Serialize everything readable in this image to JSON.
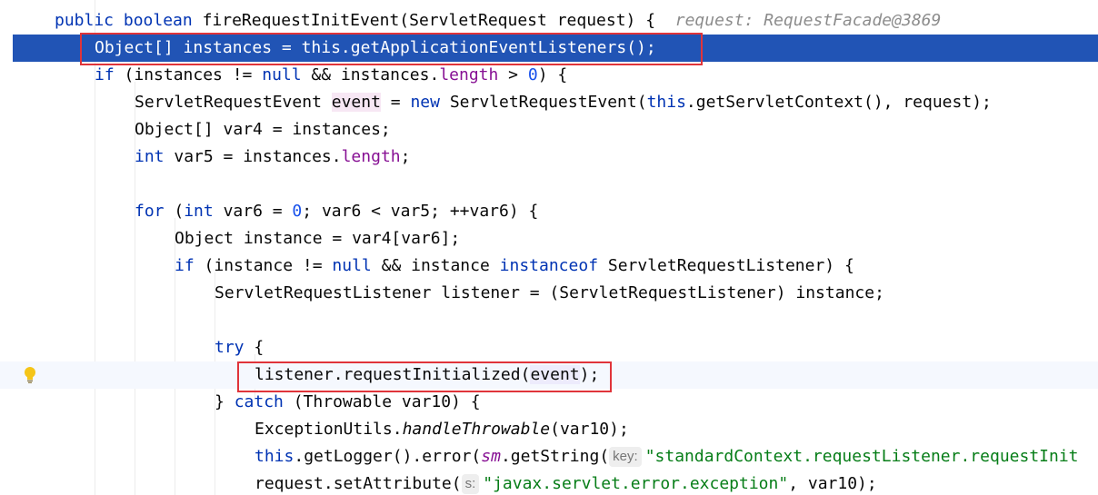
{
  "editor": {
    "lines": [
      {
        "id": "l0",
        "tokens": [
          {
            "t": "public ",
            "c": "kw"
          },
          {
            "t": "boolean ",
            "c": "kw"
          },
          {
            "t": "fireRequestInitEvent(ServletRequest request) {  "
          },
          {
            "t": "request: RequestFacade@3869",
            "c": "hint-val"
          }
        ]
      },
      {
        "id": "l1",
        "tokens": [
          {
            "t": "Object[] instances = this.getApplicationEventListeners();"
          }
        ]
      },
      {
        "id": "l2",
        "tokens": [
          {
            "t": "if ",
            "c": "kw"
          },
          {
            "t": "(instances != "
          },
          {
            "t": "null",
            "c": "kw"
          },
          {
            "t": " && instances."
          },
          {
            "t": "length",
            "c": "field"
          },
          {
            "t": " > "
          },
          {
            "t": "0",
            "c": "num"
          },
          {
            "t": ") {"
          }
        ]
      },
      {
        "id": "l3",
        "tokens": [
          {
            "t": "ServletRequestEvent "
          },
          {
            "t": "event",
            "c": "hl-var"
          },
          {
            "t": " = "
          },
          {
            "t": "new ",
            "c": "kw"
          },
          {
            "t": "ServletRequestEvent("
          },
          {
            "t": "this",
            "c": "kw"
          },
          {
            "t": ".getServletContext(), request);"
          }
        ]
      },
      {
        "id": "l4",
        "tokens": [
          {
            "t": "Object[] var4 = instances;"
          }
        ]
      },
      {
        "id": "l5",
        "tokens": [
          {
            "t": "int ",
            "c": "kw"
          },
          {
            "t": "var5 = instances."
          },
          {
            "t": "length",
            "c": "field"
          },
          {
            "t": ";"
          }
        ]
      },
      {
        "id": "l6",
        "tokens": []
      },
      {
        "id": "l7",
        "tokens": [
          {
            "t": "for ",
            "c": "kw"
          },
          {
            "t": "("
          },
          {
            "t": "int ",
            "c": "kw"
          },
          {
            "t": "var6 = "
          },
          {
            "t": "0",
            "c": "num"
          },
          {
            "t": "; var6 < var5; ++var6) {"
          }
        ]
      },
      {
        "id": "l8",
        "tokens": [
          {
            "t": "Object instance = var4[var6];"
          }
        ]
      },
      {
        "id": "l9",
        "tokens": [
          {
            "t": "if ",
            "c": "kw"
          },
          {
            "t": "(instance != "
          },
          {
            "t": "null",
            "c": "kw"
          },
          {
            "t": " && instance "
          },
          {
            "t": "instanceof ",
            "c": "kw"
          },
          {
            "t": "ServletRequestListener) {"
          }
        ]
      },
      {
        "id": "l10",
        "tokens": [
          {
            "t": "ServletRequestListener listener = (ServletRequestListener) instance;"
          }
        ]
      },
      {
        "id": "l11",
        "tokens": []
      },
      {
        "id": "l12",
        "tokens": [
          {
            "t": "try ",
            "c": "kw"
          },
          {
            "t": "{"
          }
        ]
      },
      {
        "id": "l13",
        "tokens": [
          {
            "t": "listener.requestInitialized("
          },
          {
            "t": "event",
            "c": "hl-var2"
          },
          {
            "t": ");"
          }
        ]
      },
      {
        "id": "l14",
        "tokens": [
          {
            "t": "} "
          },
          {
            "t": "catch ",
            "c": "kw"
          },
          {
            "t": "(Throwable var10) {"
          }
        ]
      },
      {
        "id": "l15",
        "tokens": [
          {
            "t": "ExceptionUtils."
          },
          {
            "t": "handleThrowable",
            "c": "it"
          },
          {
            "t": "(var10);"
          }
        ]
      },
      {
        "id": "l16",
        "tokens": [
          {
            "t": "this",
            "c": "kw"
          },
          {
            "t": ".getLogger().error("
          },
          {
            "t": "sm",
            "c": "field it"
          },
          {
            "t": ".getString("
          },
          {
            "t": "key:",
            "c": "pname"
          },
          {
            "t": "\"standardContext.requestListener.requestInit",
            "c": "str"
          }
        ]
      },
      {
        "id": "l17",
        "tokens": [
          {
            "t": "request.setAttribute("
          },
          {
            "t": "s:",
            "c": "pname"
          },
          {
            "t": "\"javax.servlet.error.exception\"",
            "c": "str"
          },
          {
            "t": ", var10);"
          }
        ]
      }
    ]
  },
  "icons": {
    "intention": "lightbulb-icon"
  },
  "colors": {
    "keyword": "#0033b3",
    "number": "#1750eb",
    "field": "#871094",
    "string": "#067d17",
    "execution_line": "#2154b5",
    "highlight_box": "#e0343a"
  }
}
